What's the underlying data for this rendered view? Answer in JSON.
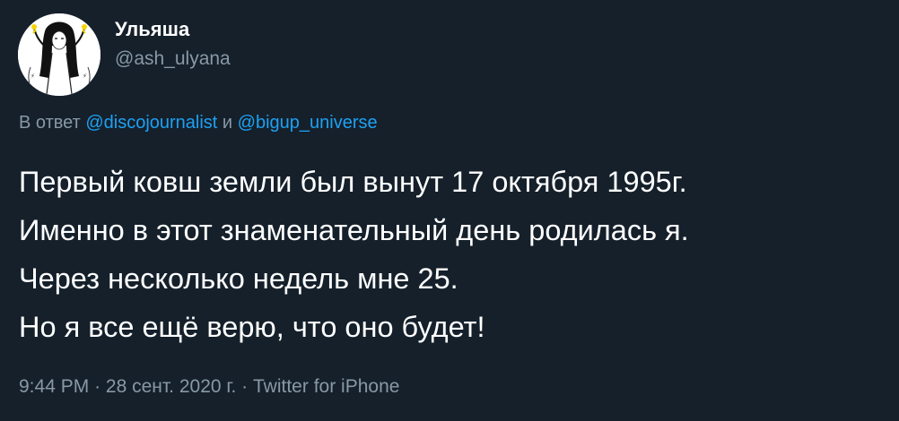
{
  "author": {
    "display_name": "Ульяша",
    "handle": "@ash_ulyana",
    "avatar_icon": "user-avatar"
  },
  "reply": {
    "prefix": "В ответ",
    "mention_1": "@discojournalist",
    "conjunction": "и",
    "mention_2": "@bigup_universe"
  },
  "tweet": {
    "lines": [
      "Первый ковш земли был вынут 17 октября 1995г.",
      "Именно в этот знаменательный день родилась я.",
      "Через несколько недель мне 25.",
      "Но я все ещё верю, что оно будет!"
    ]
  },
  "meta": {
    "time": "9:44 PM",
    "separator": "·",
    "date": "28 сент. 2020 г.",
    "source": "Twitter for iPhone"
  },
  "colors": {
    "background": "#15202b",
    "text": "#ffffff",
    "secondary": "#8899a6",
    "accent": "#1da1f2"
  }
}
